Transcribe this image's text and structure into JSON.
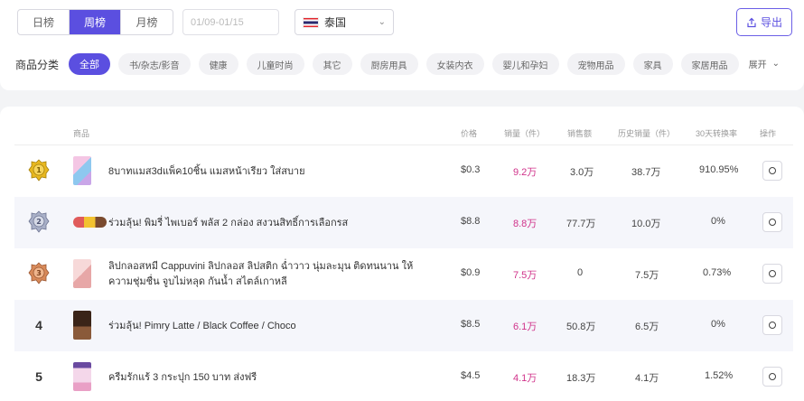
{
  "period_tabs": [
    {
      "label": "日榜",
      "active": false
    },
    {
      "label": "周榜",
      "active": true
    },
    {
      "label": "月榜",
      "active": false
    }
  ],
  "date_range": {
    "placeholder": "01/09-01/15"
  },
  "country": {
    "name": "泰国",
    "flag_icon": "thailand-flag-icon"
  },
  "export": {
    "label": "导出",
    "icon": "export-icon"
  },
  "categories": {
    "label": "商品分类",
    "items": [
      "全部",
      "书/杂志/影音",
      "健康",
      "儿童时尚",
      "其它",
      "厨房用具",
      "女装内衣",
      "婴儿和孕妇",
      "宠物用品",
      "家具",
      "家居用品"
    ],
    "active_index": 0,
    "expand_label": "展开"
  },
  "table": {
    "headers": {
      "product": "商品",
      "price": "价格",
      "sales": "销量（件）",
      "revenue": "销售额",
      "history": "历史销量（件）",
      "conversion": "30天转换率",
      "action": "操作"
    },
    "rows": [
      {
        "rank": "1",
        "medal": "gold-medal-icon",
        "name": "8บาทแมส3dแพ็ค10ชิ้น แมสหน้าเรียว ใส่สบาย",
        "price": "$0.3",
        "sales": "9.2万",
        "revenue": "3.0万",
        "history": "38.7万",
        "conversion": "910.95%"
      },
      {
        "rank": "2",
        "medal": "silver-medal-icon",
        "name": "ร่วมลุ้น! พิมรี่ ไพเบอร์ พลัส 2 กล่อง สงวนสิทธิ์การเลือกรส",
        "price": "$8.8",
        "sales": "8.8万",
        "revenue": "77.7万",
        "history": "10.0万",
        "conversion": "0%"
      },
      {
        "rank": "3",
        "medal": "bronze-medal-icon",
        "name": "ลิปกลอสหมี Cappuvini ลิปกลอส ลิปสติก ฉ่ำวาว นุ่มละมุน ติดทนนาน ให้ความชุ่มชื่น จูบไม่หลุด กันน้ำ สไตล์เกาหลี",
        "price": "$0.9",
        "sales": "7.5万",
        "revenue": "0",
        "history": "7.5万",
        "conversion": "0.73%"
      },
      {
        "rank": "4",
        "medal": "",
        "name": "ร่วมลุ้น! Pimry Latte / Black Coffee / Choco",
        "price": "$8.5",
        "sales": "6.1万",
        "revenue": "50.8万",
        "history": "6.5万",
        "conversion": "0%"
      },
      {
        "rank": "5",
        "medal": "",
        "name": "ครีมรักแร้ 3 กระปุก 150 บาท ส่งฟรี",
        "price": "$4.5",
        "sales": "4.1万",
        "revenue": "18.3万",
        "history": "4.1万",
        "conversion": "1.52%"
      }
    ]
  },
  "colors": {
    "accent": "#5b4fe0",
    "sales_pink": "#d0328a"
  }
}
